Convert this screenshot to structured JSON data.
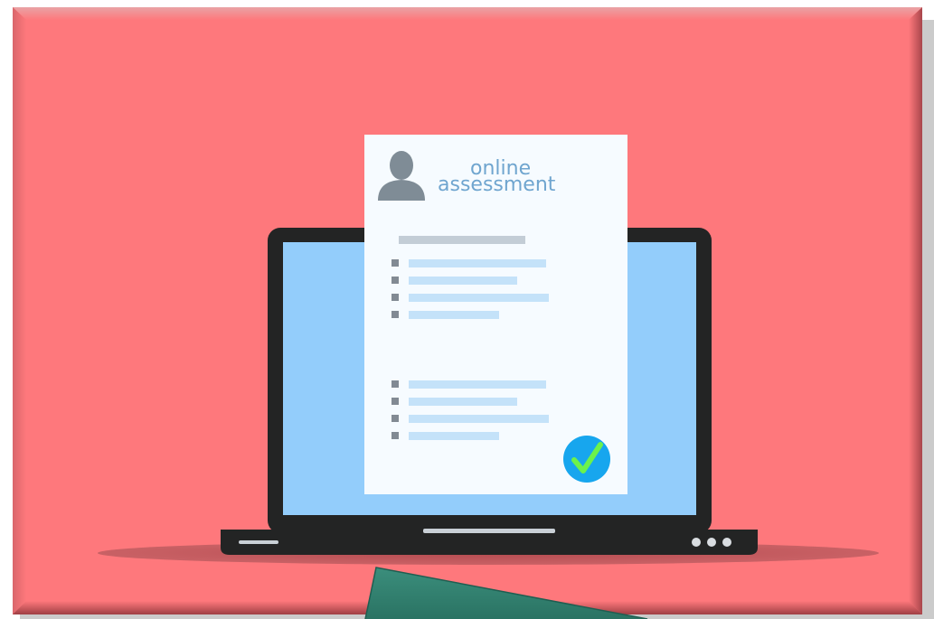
{
  "illustration": {
    "title_line1": "online",
    "title_line2": "assessment",
    "icons": {
      "person": "user-avatar-icon",
      "check": "checkmark-icon",
      "dots": "three-dots-icon"
    },
    "colors": {
      "background": "#fe787c",
      "frame_border": "#c4555a",
      "laptop_body": "#232424",
      "screen": "#93cdfb",
      "document": "#f6fbff",
      "title_text": "#6fa5cf",
      "avatar": "#7f8c96",
      "header_bar": "#c3cdd6",
      "list_line": "#c4e2f9",
      "bullet": "#828a93",
      "check_circle": "#17a6ee",
      "check_mark": "#6cf24b",
      "shadow": "#c4555a",
      "tab": "#31806f"
    }
  }
}
